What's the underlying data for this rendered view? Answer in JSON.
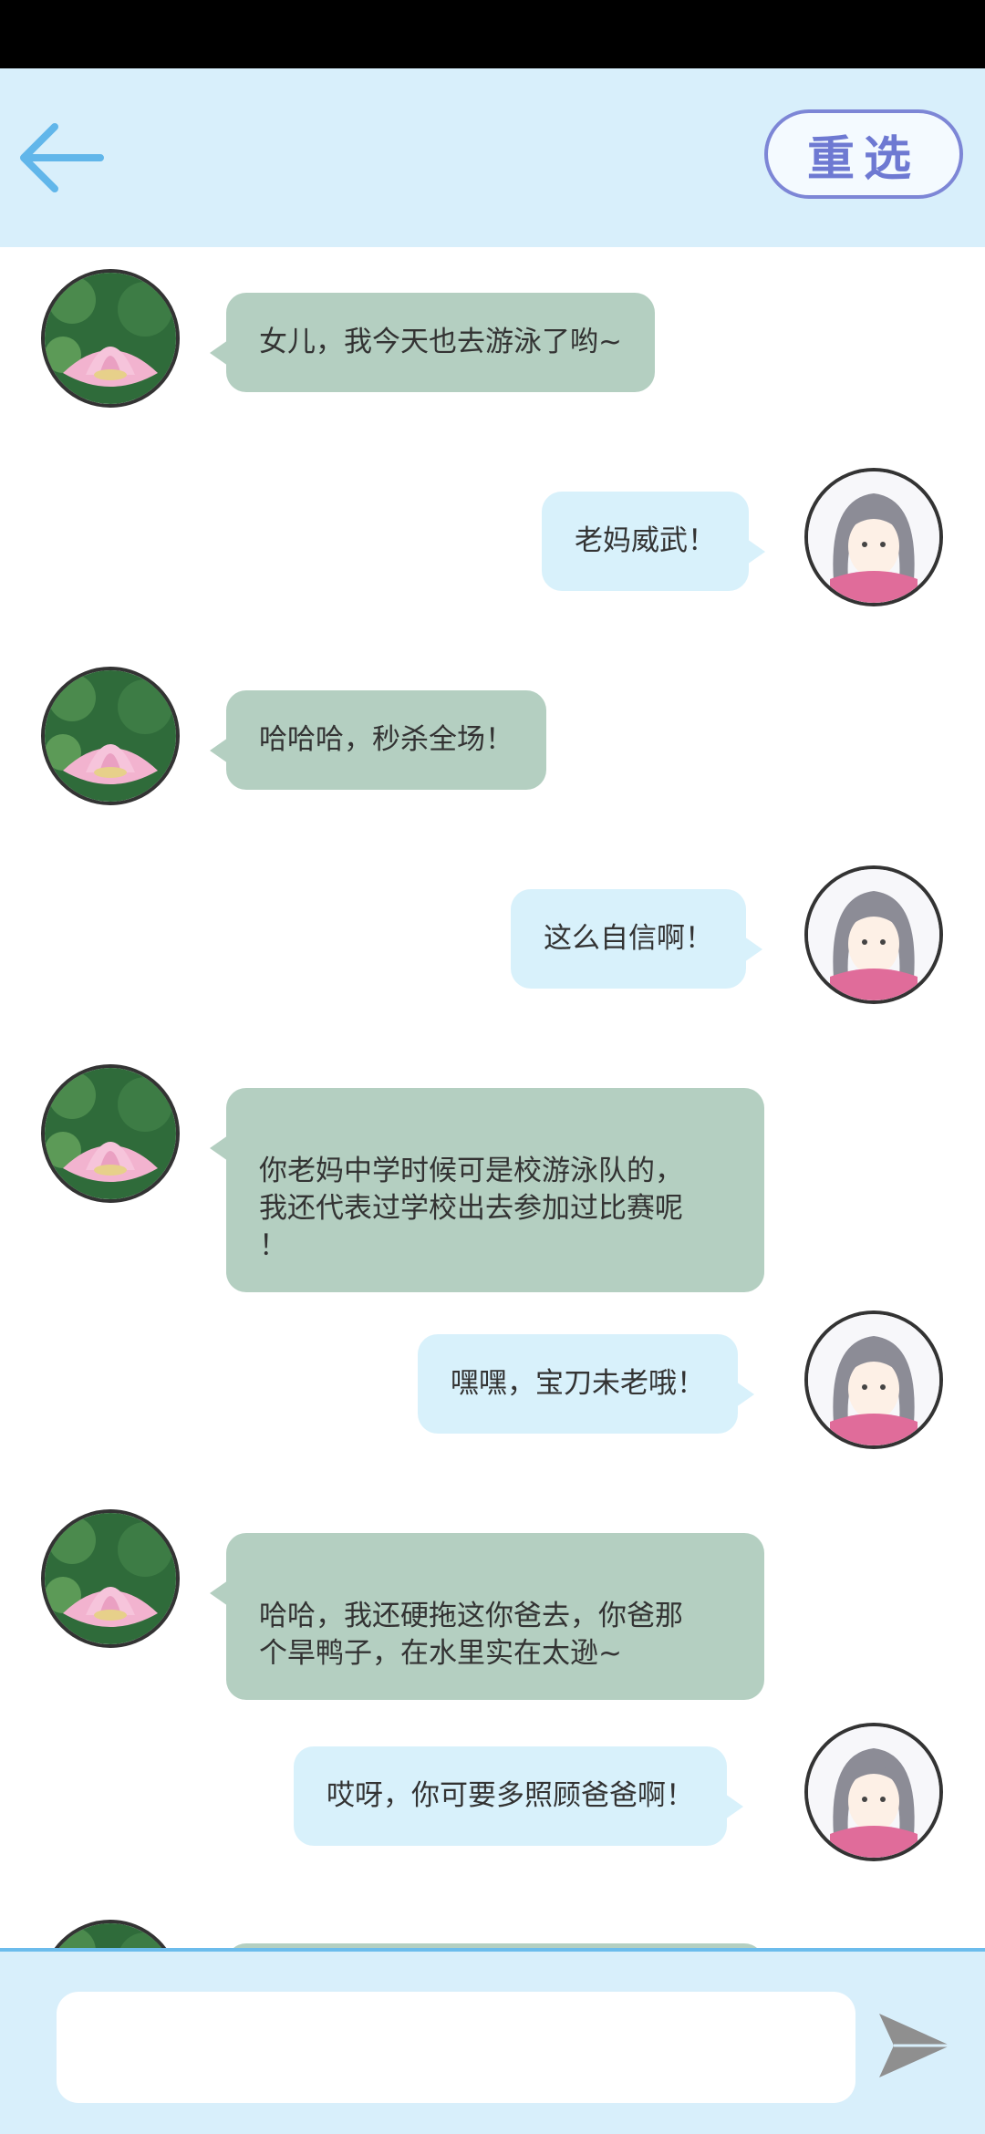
{
  "header": {
    "reselect_label": "重选"
  },
  "messages": [
    {
      "side": "left",
      "text": "女儿，我今天也去游泳了哟~"
    },
    {
      "side": "right",
      "text": "老妈威武！"
    },
    {
      "side": "left",
      "text": "哈哈哈，秒杀全场！"
    },
    {
      "side": "right",
      "text": "这么自信啊！"
    },
    {
      "side": "left",
      "text": "你老妈中学时候可是校游泳队的，\n我还代表过学校出去参加过比赛呢\n！"
    },
    {
      "side": "right",
      "text": "嘿嘿，宝刀未老哦！"
    },
    {
      "side": "left",
      "text": "哈哈，我还硬拖这你爸去，你爸那\n个旱鸭子，在水里实在太逊~"
    },
    {
      "side": "right",
      "text": "哎呀，你可要多照顾爸爸啊！"
    }
  ],
  "composer": {
    "value": "",
    "placeholder": ""
  },
  "icons": {
    "back": "arrow-left-icon",
    "send": "send-icon",
    "mother_avatar": "lotus-avatar",
    "daughter_avatar": "girl-avatar"
  },
  "colors": {
    "header_bg": "#d8effb",
    "left_bubble": "#b4cfc1",
    "right_bubble": "#d8f1fb",
    "accent": "#6cbcec"
  }
}
